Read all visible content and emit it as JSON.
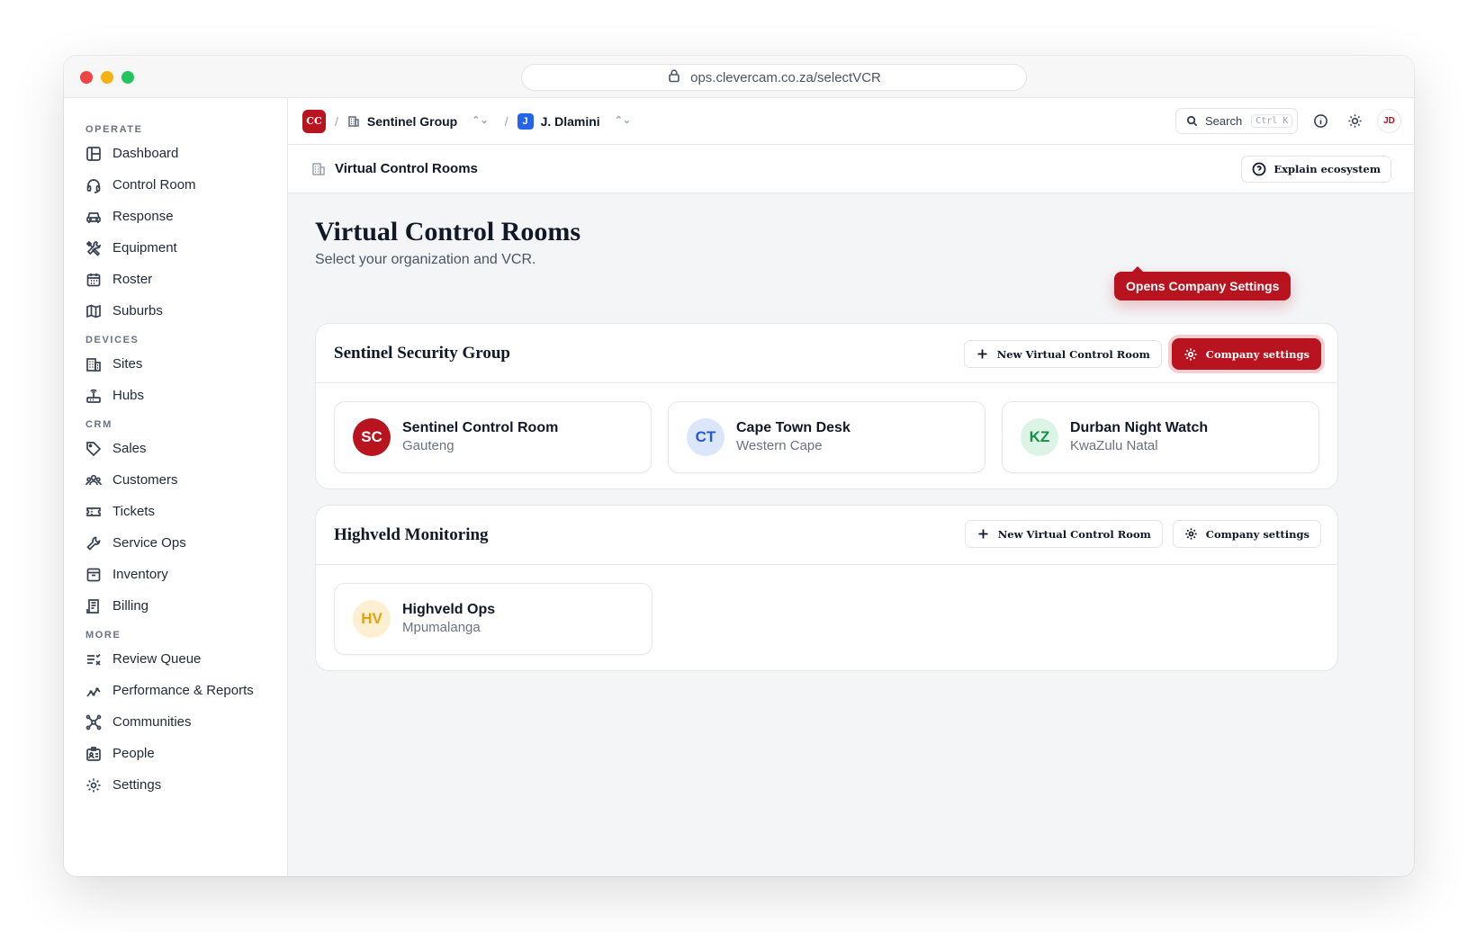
{
  "browser": {
    "url": "ops.clevercam.co.za/selectVCR"
  },
  "sidebar": {
    "sections": [
      {
        "label": "OPERATE",
        "items": [
          {
            "label": "Dashboard",
            "icon": "layout-icon"
          },
          {
            "label": "Control Room",
            "icon": "headset-icon"
          },
          {
            "label": "Response",
            "icon": "car-icon"
          },
          {
            "label": "Equipment",
            "icon": "tools-icon"
          },
          {
            "label": "Roster",
            "icon": "calendar-icon"
          },
          {
            "label": "Suburbs",
            "icon": "map-icon"
          }
        ]
      },
      {
        "label": "DEVICES",
        "items": [
          {
            "label": "Sites",
            "icon": "building-icon"
          },
          {
            "label": "Hubs",
            "icon": "router-icon"
          }
        ]
      },
      {
        "label": "CRM",
        "items": [
          {
            "label": "Sales",
            "icon": "tag-icon"
          },
          {
            "label": "Customers",
            "icon": "users-icon"
          },
          {
            "label": "Tickets",
            "icon": "ticket-icon"
          },
          {
            "label": "Service Ops",
            "icon": "wrench-icon"
          },
          {
            "label": "Inventory",
            "icon": "archive-icon"
          },
          {
            "label": "Billing",
            "icon": "receipt-icon"
          }
        ]
      },
      {
        "label": "MORE",
        "items": [
          {
            "label": "Review Queue",
            "icon": "list-x-icon"
          },
          {
            "label": "Performance & Reports",
            "icon": "trend-icon"
          },
          {
            "label": "Communities",
            "icon": "network-icon"
          },
          {
            "label": "People",
            "icon": "id-card-icon"
          },
          {
            "label": "Settings",
            "icon": "gear-icon"
          }
        ]
      }
    ]
  },
  "topbar": {
    "org_badge": "CC",
    "separator": "/",
    "org_name": "Sentinel Group",
    "user_badge": "J",
    "user_name": "J. Dlamini",
    "search_label": "Search",
    "search_shortcut": "Ctrl K",
    "avatar": "JD"
  },
  "subbar": {
    "title": "Virtual Control Rooms",
    "explain_label": "Explain ecosystem"
  },
  "page": {
    "title": "Virtual Control Rooms",
    "subtitle": "Select your organization and VCR.",
    "tooltip": "Opens Company Settings"
  },
  "groups": [
    {
      "name": "Sentinel Security Group",
      "new_label": "New Virtual Control Room",
      "settings_label": "Company settings",
      "vcrs": [
        {
          "initials": "SC",
          "name": "Sentinel Control Room",
          "region": "Gauteng",
          "color": "#b8141f"
        },
        {
          "initials": "CT",
          "name": "Cape Town Desk",
          "region": "Western Cape",
          "color": "#2557d6"
        },
        {
          "initials": "KZ",
          "name": "Durban Night Watch",
          "region": "KwaZulu Natal",
          "color": "#17904a"
        }
      ]
    },
    {
      "name": "Highveld Monitoring",
      "new_label": "New Virtual Control Room",
      "settings_label": "Company settings",
      "vcrs": [
        {
          "initials": "HV",
          "name": "Highveld Ops",
          "region": "Mpumalanga",
          "color": "#e6a012"
        }
      ]
    }
  ],
  "colors": {
    "brand": "#b8141f",
    "background": "#f4f5f7"
  }
}
